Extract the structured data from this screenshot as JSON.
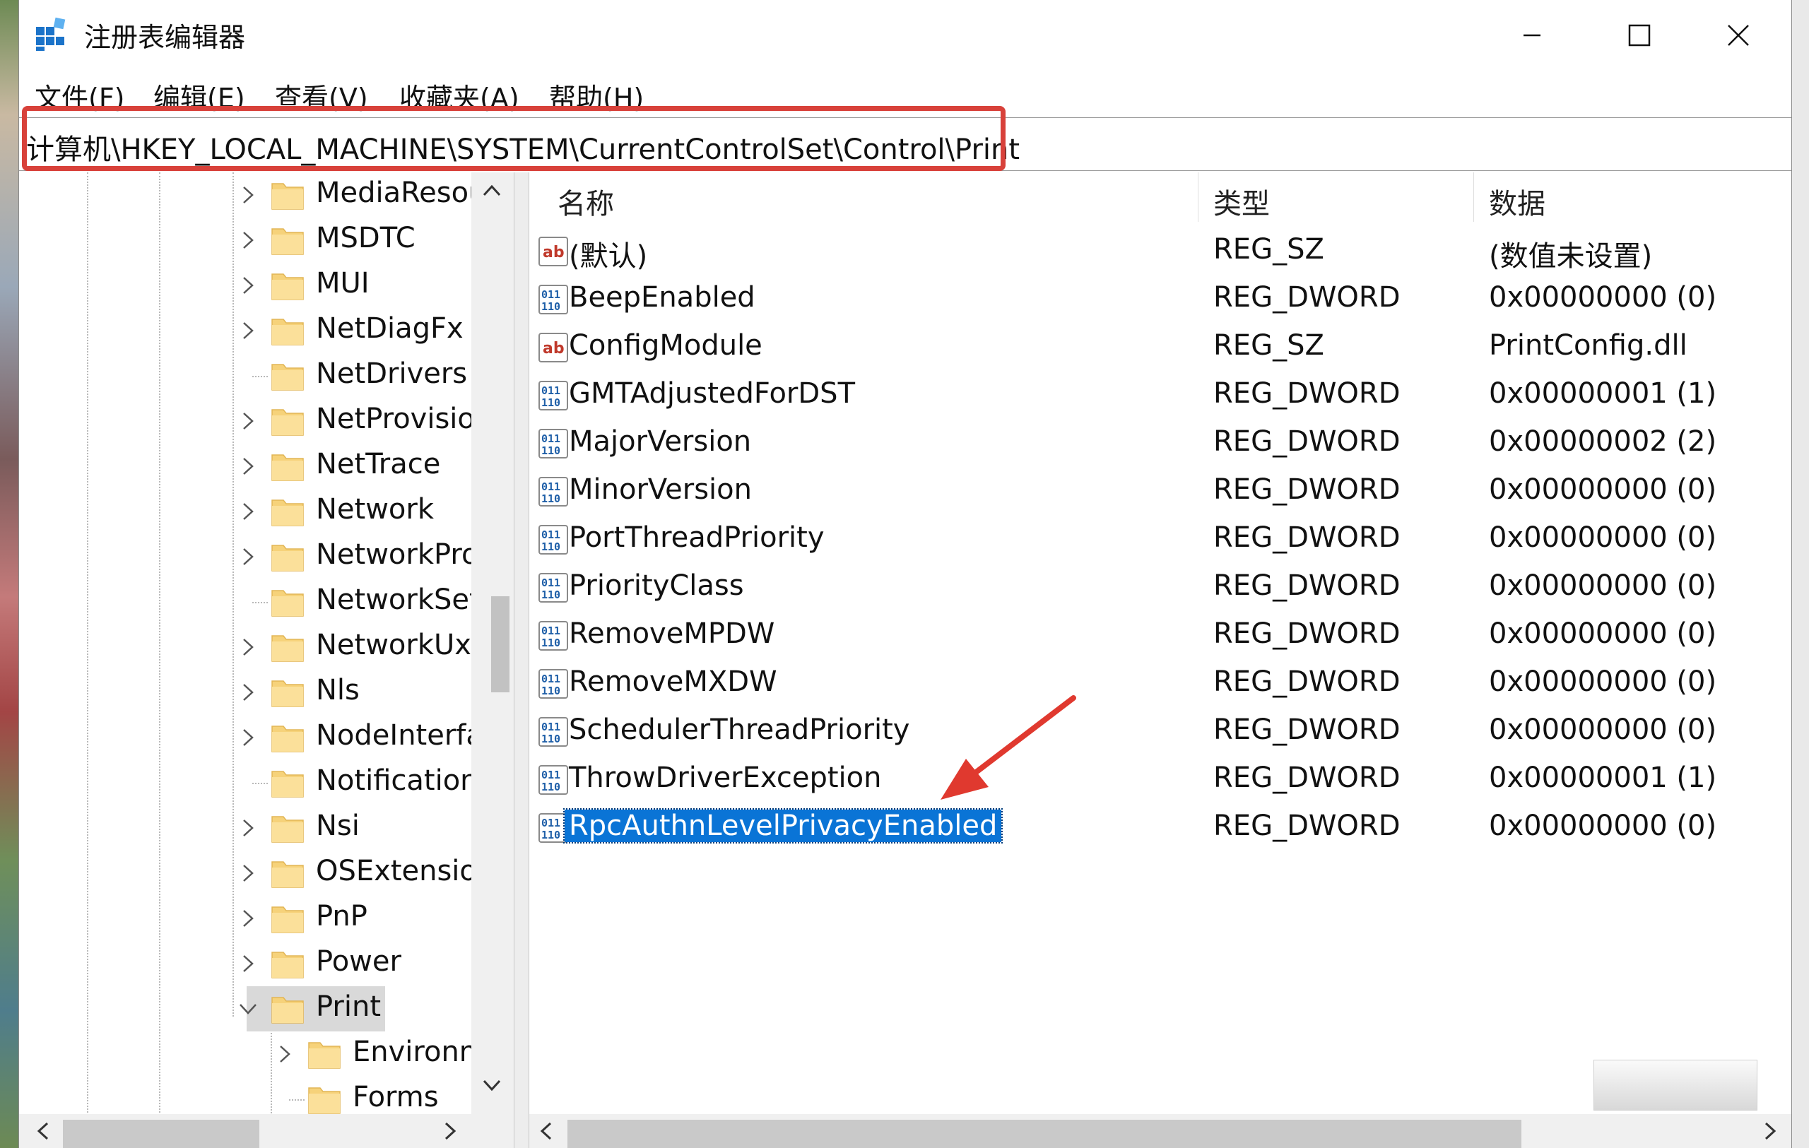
{
  "window": {
    "title": "注册表编辑器",
    "controls": {
      "minimize": "—",
      "maximize": "☐",
      "close": "✕"
    }
  },
  "menu": [
    "文件(F)",
    "编辑(E)",
    "查看(V)",
    "收藏夹(A)",
    "帮助(H)"
  ],
  "address": "计算机\\HKEY_LOCAL_MACHINE\\SYSTEM\\CurrentControlSet\\Control\\Print",
  "tree": {
    "items": [
      {
        "label": "MediaResoui",
        "expander": "collapsed"
      },
      {
        "label": "MSDTC",
        "expander": "collapsed"
      },
      {
        "label": "MUI",
        "expander": "collapsed"
      },
      {
        "label": "NetDiagFx",
        "expander": "collapsed"
      },
      {
        "label": "NetDrivers",
        "expander": "none"
      },
      {
        "label": "NetProvision",
        "expander": "collapsed"
      },
      {
        "label": "NetTrace",
        "expander": "collapsed"
      },
      {
        "label": "Network",
        "expander": "collapsed"
      },
      {
        "label": "NetworkProv",
        "expander": "collapsed"
      },
      {
        "label": "NetworkSetu",
        "expander": "none"
      },
      {
        "label": "NetworkUxM",
        "expander": "collapsed"
      },
      {
        "label": "Nls",
        "expander": "collapsed"
      },
      {
        "label": "NodeInterfac",
        "expander": "collapsed"
      },
      {
        "label": "Notifications",
        "expander": "none"
      },
      {
        "label": "Nsi",
        "expander": "collapsed"
      },
      {
        "label": "OSExtensionI",
        "expander": "collapsed"
      },
      {
        "label": "PnP",
        "expander": "collapsed"
      },
      {
        "label": "Power",
        "expander": "collapsed"
      },
      {
        "label": "Print",
        "expander": "expanded",
        "selected": true
      },
      {
        "label": "Environme",
        "expander": "collapsed",
        "child": true
      },
      {
        "label": "Forms",
        "expander": "none",
        "child": true
      }
    ]
  },
  "list": {
    "headers": {
      "name": "名称",
      "type": "类型",
      "data": "数据"
    },
    "rows": [
      {
        "icon": "string-value-icon",
        "name": "(默认)",
        "type": "REG_SZ",
        "data": "(数值未设置)"
      },
      {
        "icon": "binary-value-icon",
        "name": "BeepEnabled",
        "type": "REG_DWORD",
        "data": "0x00000000 (0)"
      },
      {
        "icon": "string-value-icon",
        "name": "ConfigModule",
        "type": "REG_SZ",
        "data": "PrintConfig.dll"
      },
      {
        "icon": "binary-value-icon",
        "name": "GMTAdjustedForDST",
        "type": "REG_DWORD",
        "data": "0x00000001 (1)"
      },
      {
        "icon": "binary-value-icon",
        "name": "MajorVersion",
        "type": "REG_DWORD",
        "data": "0x00000002 (2)"
      },
      {
        "icon": "binary-value-icon",
        "name": "MinorVersion",
        "type": "REG_DWORD",
        "data": "0x00000000 (0)"
      },
      {
        "icon": "binary-value-icon",
        "name": "PortThreadPriority",
        "type": "REG_DWORD",
        "data": "0x00000000 (0)"
      },
      {
        "icon": "binary-value-icon",
        "name": "PriorityClass",
        "type": "REG_DWORD",
        "data": "0x00000000 (0)"
      },
      {
        "icon": "binary-value-icon",
        "name": "RemoveMPDW",
        "type": "REG_DWORD",
        "data": "0x00000000 (0)"
      },
      {
        "icon": "binary-value-icon",
        "name": "RemoveMXDW",
        "type": "REG_DWORD",
        "data": "0x00000000 (0)"
      },
      {
        "icon": "binary-value-icon",
        "name": "SchedulerThreadPriority",
        "type": "REG_DWORD",
        "data": "0x00000000 (0)"
      },
      {
        "icon": "binary-value-icon",
        "name": "ThrowDriverException",
        "type": "REG_DWORD",
        "data": "0x00000001 (1)"
      },
      {
        "icon": "binary-value-icon",
        "name": "RpcAuthnLevelPrivacyEnabled",
        "type": "REG_DWORD",
        "data": "0x00000000 (0)",
        "selected": true
      }
    ]
  },
  "colors": {
    "selection": "#0a74d6",
    "annotation_red": "#d8413a",
    "folder": "#f6d27a",
    "tree_selected": "#d9d9d9"
  }
}
